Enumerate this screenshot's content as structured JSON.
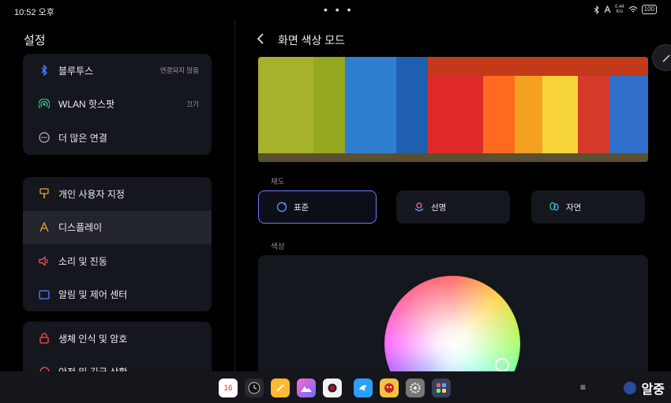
{
  "status": {
    "time": "10:52 오후",
    "dots": "• • •",
    "net_speed_value": "0.44",
    "net_speed_unit": "K/s",
    "battery": "100",
    "icons": [
      "bluetooth-icon",
      "airplane-icon",
      "wifi-icon",
      "battery-icon"
    ]
  },
  "left": {
    "title": "설정",
    "groups": [
      {
        "items": [
          {
            "label": "블루투스",
            "value": "연결되지 않음",
            "icon": "bluetooth-icon"
          },
          {
            "label": "WLAN 핫스팟",
            "value": "끄기",
            "icon": "hotspot-icon"
          },
          {
            "label": "더 많은 연결",
            "value": "",
            "icon": "more-connections-icon"
          }
        ]
      },
      {
        "items": [
          {
            "label": "개인 사용자 지정",
            "icon": "personalize-icon"
          },
          {
            "label": "디스플레이",
            "icon": "display-icon",
            "active": true
          },
          {
            "label": "소리 및 진동",
            "icon": "sound-icon"
          },
          {
            "label": "알림 및 제어 센터",
            "icon": "notification-icon"
          }
        ]
      },
      {
        "items": [
          {
            "label": "생체 인식 및 암호",
            "icon": "lock-icon"
          },
          {
            "label": "안전 및 긴급 상황",
            "icon": "emergency-icon"
          }
        ]
      }
    ]
  },
  "right": {
    "title": "화면 색상 모드",
    "saturation_label": "채도",
    "modes": [
      {
        "label": "표준",
        "icon": "standard-mode-icon",
        "selected": true
      },
      {
        "label": "선명",
        "icon": "vivid-mode-icon",
        "selected": false
      },
      {
        "label": "자연",
        "icon": "natural-mode-icon",
        "selected": false
      }
    ],
    "color_label": "색상"
  },
  "dock": {
    "calendar_day": "16",
    "apps": [
      "calendar-app-icon",
      "clock-app-icon",
      "notes-app-icon",
      "gallery-app-icon",
      "camera-app-icon",
      "browser-app-icon",
      "game-app-icon",
      "settings-app-icon",
      "app-folder-icon"
    ],
    "menu_glyph": "≡"
  },
  "watermark": "알중",
  "colors": {
    "accent": "#6a78ff",
    "card": "#15171e",
    "background": "#000000"
  }
}
